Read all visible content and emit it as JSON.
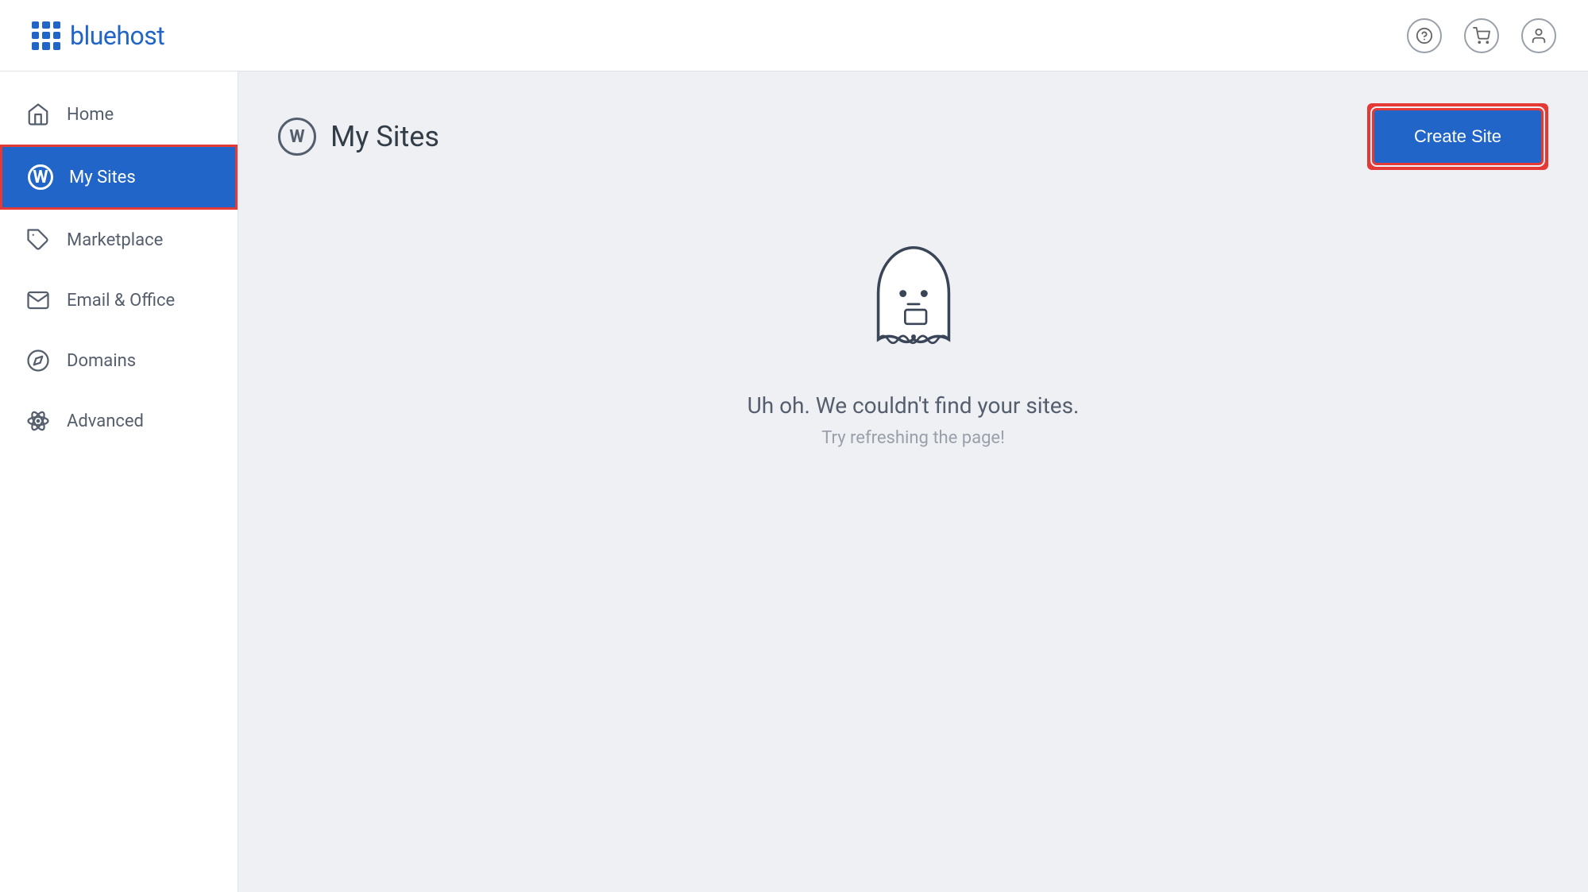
{
  "brand": {
    "logo_text": "bluehost"
  },
  "header": {
    "help_icon": "?",
    "cart_icon": "cart",
    "user_icon": "user"
  },
  "sidebar": {
    "items": [
      {
        "id": "home",
        "label": "Home",
        "icon": "home"
      },
      {
        "id": "my-sites",
        "label": "My Sites",
        "icon": "wordpress",
        "active": true
      },
      {
        "id": "marketplace",
        "label": "Marketplace",
        "icon": "tag"
      },
      {
        "id": "email-office",
        "label": "Email & Office",
        "icon": "email"
      },
      {
        "id": "domains",
        "label": "Domains",
        "icon": "compass"
      },
      {
        "id": "advanced",
        "label": "Advanced",
        "icon": "atom"
      }
    ]
  },
  "main": {
    "page_title": "My Sites",
    "create_button_label": "Create Site",
    "empty_state": {
      "title": "Uh oh. We couldn't find your sites.",
      "subtitle": "Try refreshing the page!"
    }
  }
}
